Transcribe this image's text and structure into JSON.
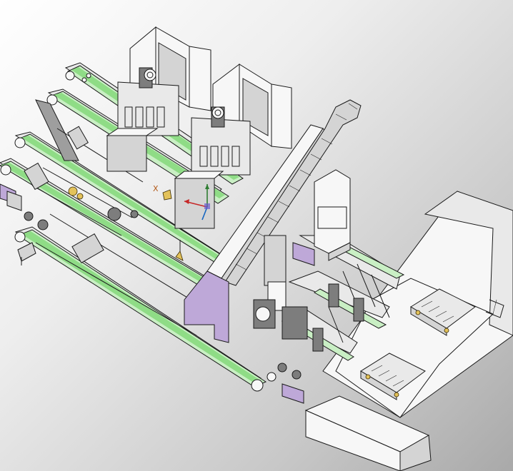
{
  "viewport": {
    "background_top": "#ffffff",
    "background_bottom": "#a9a9a9"
  },
  "model": {
    "colors": {
      "belt": "#c9efc4",
      "belt_highlight": "#8fdc86",
      "frame": "#e9e9e9",
      "bracket": "#bea8d8",
      "cylinder_tip": "#e3c25a"
    }
  },
  "triad": {
    "x_label": "X"
  }
}
